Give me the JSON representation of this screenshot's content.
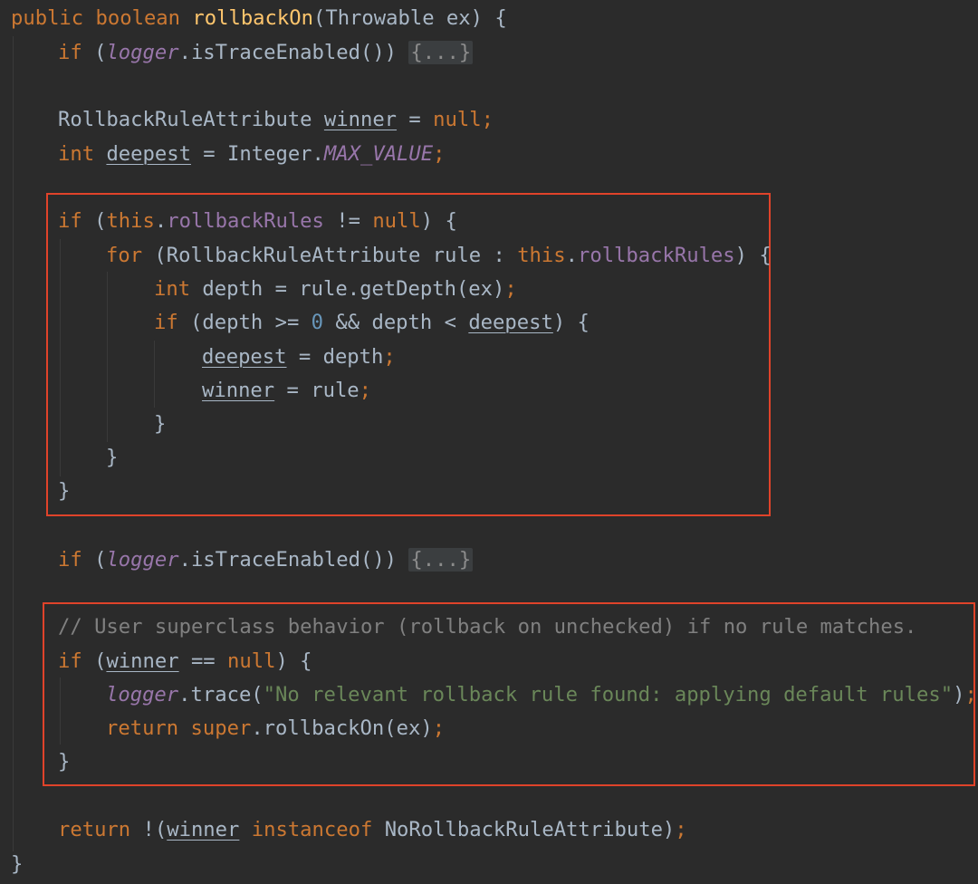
{
  "method": {
    "modifier": "public",
    "return_type": "boolean",
    "name": "rollbackOn",
    "params": "(Throwable ex) {"
  },
  "tokens": {
    "if": "if",
    "for": "for",
    "int": "int",
    "this": "this",
    "null": "null",
    "return": "return",
    "super": "super",
    "instanceof": "instanceof",
    "semicolon": ";",
    "dot": ".",
    "zero": "0",
    "open_paren": " (",
    "fold": "{...}",
    "open_brace": "{",
    "close_brace": "}"
  },
  "fields": {
    "logger": "logger",
    "rollbackRules": "rollbackRules",
    "max_value": "MAX_VALUE"
  },
  "vars": {
    "winner": "winner",
    "deepest": "deepest"
  },
  "text": {
    "is_trace_enabled": "isTraceEnabled()) ",
    "rule_attr_type": "RollbackRuleAttribute ",
    "assign_null": " = ",
    "int_space": " ",
    "assign_integer": " = Integer.",
    "not_equal": " != ",
    "close_paren_brace": ") {",
    "for_open": " (RollbackRuleAttribute rule : ",
    "depth_assign": " depth = rule.getDepth(ex)",
    "if_depth_open": " (depth >= ",
    "and_depth": " && depth < ",
    "deepest_assign": " = depth",
    "winner_assign": " = rule",
    "eq_null": " == ",
    "trace_call": "trace(",
    "trace_close": ")",
    "rollback_call": "rollbackOn(ex)",
    "return_open": " !(",
    "return_tail": "NoRollbackRuleAttribute)",
    "space": " "
  },
  "comment": "// User superclass behavior (rollback on unchecked) if no rule matches.",
  "trace_string": "\"No relevant rollback rule found: applying default rules\"",
  "colors": {
    "background": "#2b2b2b",
    "keyword": "#cc7832",
    "method_decl": "#ffc66d",
    "field": "#9876aa",
    "number": "#6897bb",
    "string": "#6a8759",
    "comment": "#808080",
    "text": "#a9b7c6",
    "highlight_box": "#e0432a"
  }
}
